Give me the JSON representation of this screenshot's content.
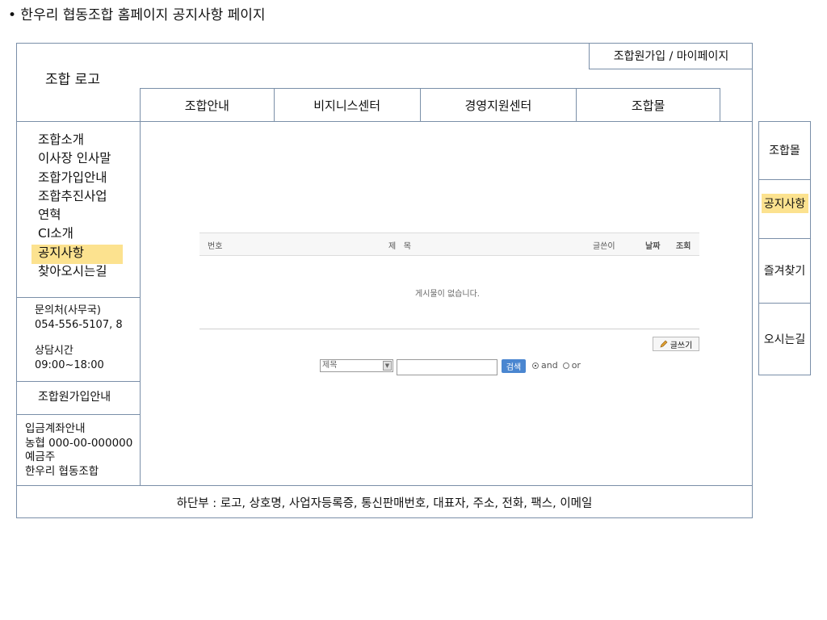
{
  "page_heading": "• 한우리 협동조합 홈페이지 공지사항 페이지",
  "header": {
    "logo_text": "조합 로고",
    "join_mypage": "조합원가입 / 마이페이지"
  },
  "nav": {
    "items": [
      "조합안내",
      "비지니스센터",
      "경영지원센터",
      "조합몰"
    ]
  },
  "sidebar": {
    "menu": [
      "조합소개",
      "이사장 인사말",
      "조합가입안내",
      "조합추진사업",
      "연혁",
      "CI소개",
      "공지사항",
      "찾아오시는길"
    ],
    "active_item": "공지사항",
    "contact": {
      "title": "문의처(사무국)",
      "phone": "054-556-5107, 8",
      "hours_title": "상담시간",
      "hours": "09:00~18:00"
    },
    "member_guide": "조합원가입안내",
    "bank": {
      "title": "입금계좌안내",
      "account": "농협 000-00-000000",
      "holder_label": "예금주",
      "holder": "한우리 협동조합"
    }
  },
  "board": {
    "columns": {
      "number": "번호",
      "title": "제   목",
      "author": "글쓴이",
      "date": "날짜",
      "views": "조회"
    },
    "empty_message": "게시물이 없습니다.",
    "write_button": "글쓰기",
    "search": {
      "selected_option": "제목",
      "input_value": "",
      "button": "검색",
      "radio_and": "and",
      "radio_or": "or",
      "selected_radio": "and"
    }
  },
  "quick_panel": {
    "items": [
      "조합몰",
      "공지사항",
      "즐겨찾기",
      "오시는길"
    ],
    "active_item": "공지사항"
  },
  "footer": {
    "text": "하단부 : 로고, 상호명, 사업자등록증, 통신판매번호, 대표자, 주소, 전화, 팩스, 이메일"
  },
  "colors": {
    "border": "#7a8fa8",
    "highlight": "#fce28f",
    "search_button": "#4a86d0"
  }
}
